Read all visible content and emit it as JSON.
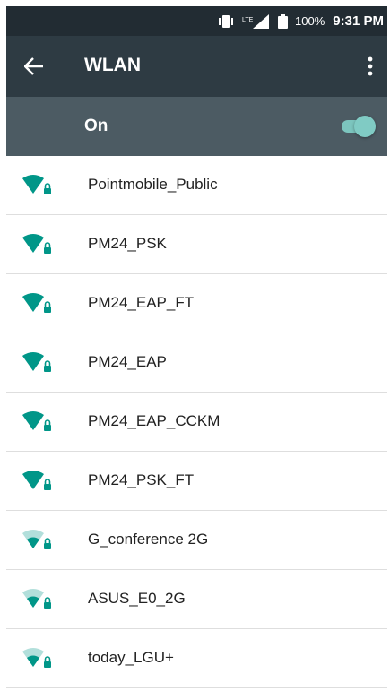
{
  "status_bar": {
    "network_label": "LTE",
    "battery_percent": "100%",
    "time": "9:31 PM"
  },
  "toolbar": {
    "title": "WLAN"
  },
  "wifi_switch": {
    "label": "On",
    "enabled": true
  },
  "colors": {
    "accent": "#009688",
    "toolbar": "#2e3b43",
    "switch_bar": "#4c5b63"
  },
  "networks": [
    {
      "name": "Pointmobile_Public",
      "signal": "full",
      "secured": true
    },
    {
      "name": "PM24_PSK",
      "signal": "full",
      "secured": true
    },
    {
      "name": "PM24_EAP_FT",
      "signal": "full",
      "secured": true
    },
    {
      "name": "PM24_EAP",
      "signal": "full",
      "secured": true
    },
    {
      "name": "PM24_EAP_CCKM",
      "signal": "full",
      "secured": true
    },
    {
      "name": "PM24_PSK_FT",
      "signal": "full",
      "secured": true
    },
    {
      "name": "G_conference 2G",
      "signal": "medium",
      "secured": true
    },
    {
      "name": "ASUS_E0_2G",
      "signal": "medium",
      "secured": true
    },
    {
      "name": "today_LGU+",
      "signal": "medium",
      "secured": true
    }
  ]
}
